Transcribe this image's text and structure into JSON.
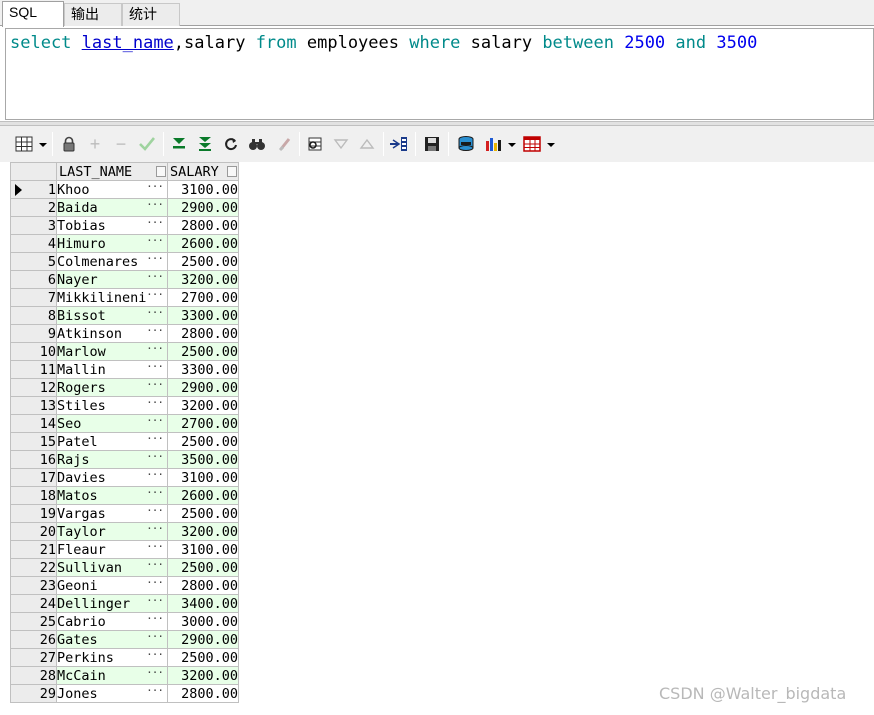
{
  "tabs": [
    {
      "label": "SQL",
      "active": true
    },
    {
      "label": "输出",
      "active": false
    },
    {
      "label": "统计",
      "active": false
    }
  ],
  "editor": {
    "tokens": [
      {
        "text": "select",
        "type": "kw"
      },
      {
        "text": " ",
        "type": "ident"
      },
      {
        "text": "last_name",
        "type": "ident-link"
      },
      {
        "text": ",salary ",
        "type": "ident"
      },
      {
        "text": "from",
        "type": "kw"
      },
      {
        "text": " employees ",
        "type": "ident"
      },
      {
        "text": "where",
        "type": "kw"
      },
      {
        "text": " salary ",
        "type": "ident"
      },
      {
        "text": "between",
        "type": "kw"
      },
      {
        "text": " ",
        "type": "ident"
      },
      {
        "text": "2500",
        "type": "num"
      },
      {
        "text": " ",
        "type": "ident"
      },
      {
        "text": "and",
        "type": "kw"
      },
      {
        "text": " ",
        "type": "ident"
      },
      {
        "text": "3500",
        "type": "num"
      }
    ]
  },
  "toolbar": {
    "icons": [
      "grid-view-icon",
      "lock-icon",
      "add-record-icon",
      "delete-record-icon",
      "post-edit-icon",
      "next-record-icon",
      "last-record-icon",
      "refresh-icon",
      "find-icon",
      "clear-icon",
      "query-by-example-icon",
      "filter-down-icon",
      "filter-up-icon",
      "export-icon",
      "save-icon",
      "fetch-icon",
      "chart-icon",
      "table-options-icon"
    ]
  },
  "grid": {
    "columns": [
      "LAST_NAME",
      "SALARY"
    ],
    "rows": [
      [
        "1",
        "Khoo",
        "3100.00"
      ],
      [
        "2",
        "Baida",
        "2900.00"
      ],
      [
        "3",
        "Tobias",
        "2800.00"
      ],
      [
        "4",
        "Himuro",
        "2600.00"
      ],
      [
        "5",
        "Colmenares",
        "2500.00"
      ],
      [
        "6",
        "Nayer",
        "3200.00"
      ],
      [
        "7",
        "Mikkilineni",
        "2700.00"
      ],
      [
        "8",
        "Bissot",
        "3300.00"
      ],
      [
        "9",
        "Atkinson",
        "2800.00"
      ],
      [
        "10",
        "Marlow",
        "2500.00"
      ],
      [
        "11",
        "Mallin",
        "3300.00"
      ],
      [
        "12",
        "Rogers",
        "2900.00"
      ],
      [
        "13",
        "Stiles",
        "3200.00"
      ],
      [
        "14",
        "Seo",
        "2700.00"
      ],
      [
        "15",
        "Patel",
        "2500.00"
      ],
      [
        "16",
        "Rajs",
        "3500.00"
      ],
      [
        "17",
        "Davies",
        "3100.00"
      ],
      [
        "18",
        "Matos",
        "2600.00"
      ],
      [
        "19",
        "Vargas",
        "2500.00"
      ],
      [
        "20",
        "Taylor",
        "3200.00"
      ],
      [
        "21",
        "Fleaur",
        "3100.00"
      ],
      [
        "22",
        "Sullivan",
        "2500.00"
      ],
      [
        "23",
        "Geoni",
        "2800.00"
      ],
      [
        "24",
        "Dellinger",
        "3400.00"
      ],
      [
        "25",
        "Cabrio",
        "3000.00"
      ],
      [
        "26",
        "Gates",
        "2900.00"
      ],
      [
        "27",
        "Perkins",
        "2500.00"
      ],
      [
        "28",
        "McCain",
        "3200.00"
      ],
      [
        "29",
        "Jones",
        "2800.00"
      ]
    ]
  },
  "watermark": "CSDN @Walter_bigdata"
}
